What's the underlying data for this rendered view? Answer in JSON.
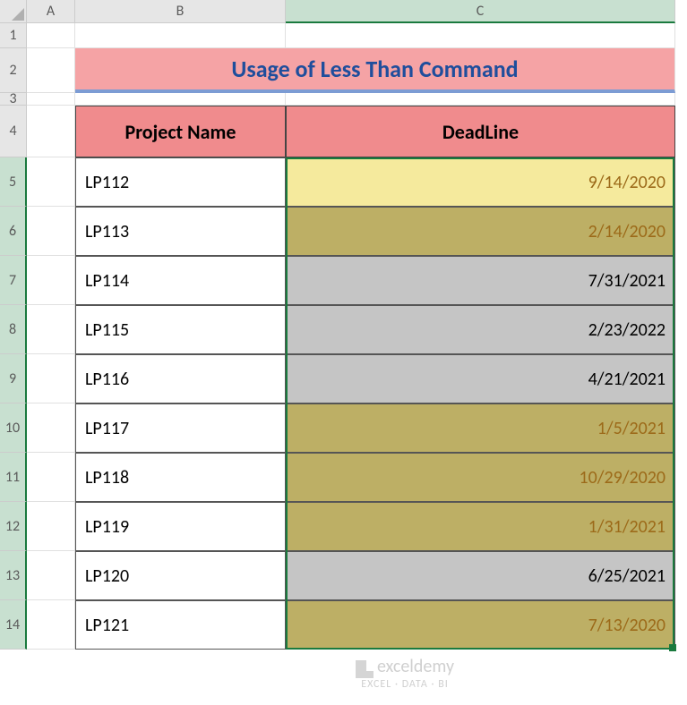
{
  "columns": [
    "A",
    "B",
    "C"
  ],
  "rows": [
    "1",
    "2",
    "3",
    "4",
    "5",
    "6",
    "7",
    "8",
    "9",
    "10",
    "11",
    "12",
    "13",
    "14"
  ],
  "title": "Usage of Less Than Command",
  "headers": {
    "project": "Project Name",
    "deadline": "DeadLine"
  },
  "data": [
    {
      "project": "LP112",
      "deadline": "9/14/2020",
      "fill": "bg-yellow-light"
    },
    {
      "project": "LP113",
      "deadline": "2/14/2020",
      "fill": "bg-olive"
    },
    {
      "project": "LP114",
      "deadline": "7/31/2021",
      "fill": "bg-gray"
    },
    {
      "project": "LP115",
      "deadline": "2/23/2022",
      "fill": "bg-gray"
    },
    {
      "project": "LP116",
      "deadline": "4/21/2021",
      "fill": "bg-gray"
    },
    {
      "project": "LP117",
      "deadline": "1/5/2021",
      "fill": "bg-olive"
    },
    {
      "project": "LP118",
      "deadline": "10/29/2020",
      "fill": "bg-olive"
    },
    {
      "project": "LP119",
      "deadline": "1/31/2021",
      "fill": "bg-olive"
    },
    {
      "project": "LP120",
      "deadline": "6/25/2021",
      "fill": "bg-gray"
    },
    {
      "project": "LP121",
      "deadline": "7/13/2020",
      "fill": "bg-olive"
    }
  ],
  "watermark": {
    "main": "exceldemy",
    "sub": "EXCEL · DATA · BI"
  },
  "chart_data": {
    "type": "table",
    "title": "Usage of Less Than Command",
    "columns": [
      "Project Name",
      "DeadLine"
    ],
    "rows": [
      [
        "LP112",
        "9/14/2020"
      ],
      [
        "LP113",
        "2/14/2020"
      ],
      [
        "LP114",
        "7/31/2021"
      ],
      [
        "LP115",
        "2/23/2022"
      ],
      [
        "LP116",
        "4/21/2021"
      ],
      [
        "LP117",
        "1/5/2021"
      ],
      [
        "LP118",
        "10/29/2020"
      ],
      [
        "LP119",
        "1/31/2021"
      ],
      [
        "LP120",
        "6/25/2021"
      ],
      [
        "LP121",
        "7/13/2020"
      ]
    ]
  }
}
